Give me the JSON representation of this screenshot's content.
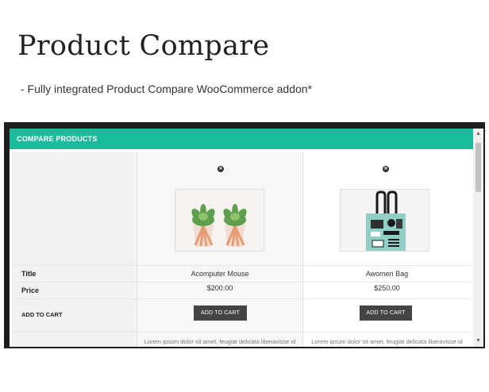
{
  "hero": {
    "title": "Product Compare",
    "subtitle": "- Fully integrated Product Compare WooCommerce addon*"
  },
  "modal": {
    "header_title": "COMPARE PRODUCTS",
    "accent_color": "#1abc9c"
  },
  "rows": {
    "title_label": "Title",
    "price_label": "Price",
    "add_to_cart_label": "ADD TO CART"
  },
  "products": [
    {
      "name": "Acomputer Mouse",
      "price": "$200.00",
      "cart_button": "ADD TO CART",
      "description": "Lorem ipsum dolor sit amet, feugiat delicata liberavisse id",
      "remove_icon": "remove-circle-icon",
      "image": "succulent-planters-image"
    },
    {
      "name": "Awomen Bag",
      "price": "$250.00",
      "cart_button": "ADD TO CART",
      "description": "Lorem ipsum dolor sit amet, feugiat delicata liberavisse id",
      "remove_icon": "remove-circle-icon",
      "image": "tote-bag-image"
    }
  ],
  "scrollbar": {
    "up_arrow": "▲",
    "down_arrow": "▼"
  }
}
